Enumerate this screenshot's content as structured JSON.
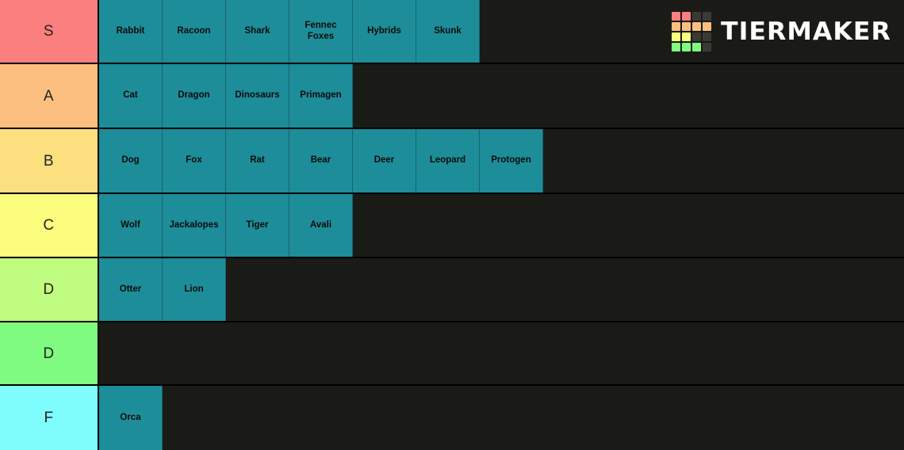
{
  "brand": {
    "name": "TIERMAKER",
    "logo_icon": "tiermaker-grid-icon",
    "logo_grid_colors": [
      "#fc7f7f",
      "#fc7f7f",
      "#3a3a35",
      "#3a3a35",
      "#fcbf7f",
      "#fcbf7f",
      "#fcbf7f",
      "#fcbf7f",
      "#fcfc7f",
      "#fcfc7f",
      "#3a3a35",
      "#3a3a35",
      "#7ffc7f",
      "#7ffc7f",
      "#7ffc7f",
      "#3a3a35"
    ]
  },
  "palette": {
    "background": "#1a1a17",
    "item": "#1d8d99",
    "item_border": "#14666f",
    "row_divider": "#000000",
    "label_text": "#26231f",
    "item_text": "#0b0b0b"
  },
  "tiers": [
    {
      "label": "S",
      "color": "#fc7f7f",
      "items": [
        "Rabbit",
        "Racoon",
        "Shark",
        "Fennec Foxes",
        "Hybrids",
        "Skunk"
      ]
    },
    {
      "label": "A",
      "color": "#fcbf7f",
      "items": [
        "Cat",
        "Dragon",
        "Dinosaurs",
        "Primagen"
      ]
    },
    {
      "label": "B",
      "color": "#fcdf7f",
      "items": [
        "Dog",
        "Fox",
        "Rat",
        "Bear",
        "Deer",
        "Leopard",
        "Protogen"
      ]
    },
    {
      "label": "C",
      "color": "#fcfc7f",
      "items": [
        "Wolf",
        "Jackalopes",
        "Tiger",
        "Avali"
      ]
    },
    {
      "label": "D",
      "color": "#bffc7f",
      "items": [
        "Otter",
        "Lion"
      ]
    },
    {
      "label": "D",
      "color": "#7ffc7f",
      "items": []
    },
    {
      "label": "F",
      "color": "#7ffcfc",
      "items": [
        "Orca"
      ]
    }
  ]
}
